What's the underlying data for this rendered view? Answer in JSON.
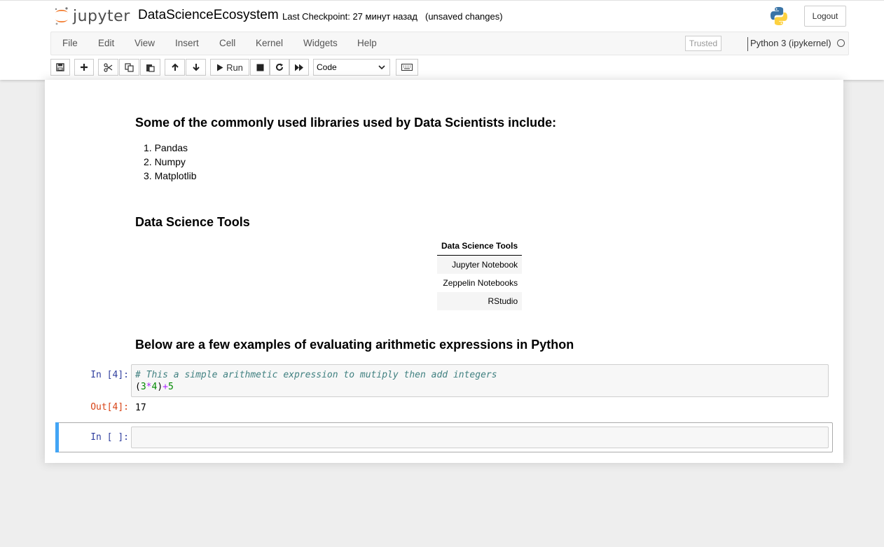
{
  "header": {
    "logo_text": "jupyter",
    "notebook_name": "DataScienceEcosystem",
    "checkpoint": "Last Checkpoint: 27 минут назад",
    "autosave": "(unsaved changes)",
    "logout": "Logout"
  },
  "menubar": {
    "items": [
      "File",
      "Edit",
      "View",
      "Insert",
      "Cell",
      "Kernel",
      "Widgets",
      "Help"
    ],
    "trusted": "Trusted",
    "kernel": "Python 3 (ipykernel)"
  },
  "toolbar": {
    "run_label": "Run",
    "cell_type": "Code"
  },
  "notebook": {
    "libraries_heading": "Some of the commonly used libraries used by Data Scientists include:",
    "libraries": [
      "1. Pandas",
      "2. Numpy",
      "3. Matplotlib"
    ],
    "tools_heading": "Data Science Tools",
    "tools_table_header": "Data Science Tools",
    "tools": [
      "Jupyter Notebook",
      "Zeppelin Notebooks",
      "RStudio"
    ],
    "arith_heading": "Below are a few examples of evaluating arithmetic expressions in Python",
    "code_cell": {
      "prompt": "In [4]:",
      "comment": "# This a simple arithmetic expression to mutiply then add integers",
      "line2_open": "(",
      "line2_a": "3",
      "line2_mul": "*",
      "line2_b": "4",
      "line2_close": ")",
      "line2_plus": "+",
      "line2_c": "5"
    },
    "output": {
      "prompt": "Out[4]:",
      "value": "17"
    },
    "empty_cell": {
      "prompt": "In [ ]:"
    }
  },
  "colors": {
    "selected_cell_bar": "#42a5f5",
    "in_prompt": "#303f9f",
    "out_prompt": "#d84315",
    "logo_orange": "#f37726"
  },
  "icons": [
    "save-icon",
    "plus-icon",
    "cut-icon",
    "copy-icon",
    "paste-icon",
    "arrow-up-icon",
    "arrow-down-icon",
    "play-icon",
    "stop-icon",
    "restart-icon",
    "fast-forward-icon",
    "keyboard-icon",
    "python-icon"
  ]
}
